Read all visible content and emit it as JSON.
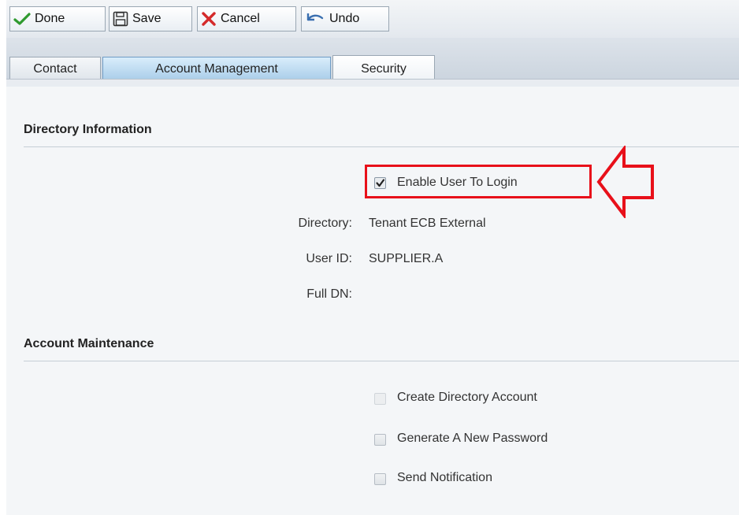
{
  "toolbar": {
    "done_label": "Done",
    "save_label": "Save",
    "cancel_label": "Cancel",
    "undo_label": "Undo"
  },
  "tabs": [
    {
      "label": "Contact",
      "active": false
    },
    {
      "label": "Account Management",
      "active": true
    },
    {
      "label": "Security",
      "active": false
    }
  ],
  "directory_section": {
    "title": "Directory Information",
    "enable_login": {
      "label": "Enable User To Login",
      "checked": true
    },
    "fields": [
      {
        "label": "Directory:",
        "value": "Tenant ECB External"
      },
      {
        "label": "User ID:",
        "value": "SUPPLIER.A"
      },
      {
        "label": "Full DN:",
        "value": ""
      }
    ]
  },
  "maintenance_section": {
    "title": "Account Maintenance",
    "options": [
      {
        "label": "Create Directory Account",
        "checked": false,
        "disabled": true
      },
      {
        "label": "Generate A New Password",
        "checked": false,
        "disabled": false
      },
      {
        "label": "Send Notification",
        "checked": false,
        "disabled": false
      }
    ]
  },
  "annotation": {
    "color": "#e8101a",
    "shape": "left-pointing-arrow-and-box"
  }
}
